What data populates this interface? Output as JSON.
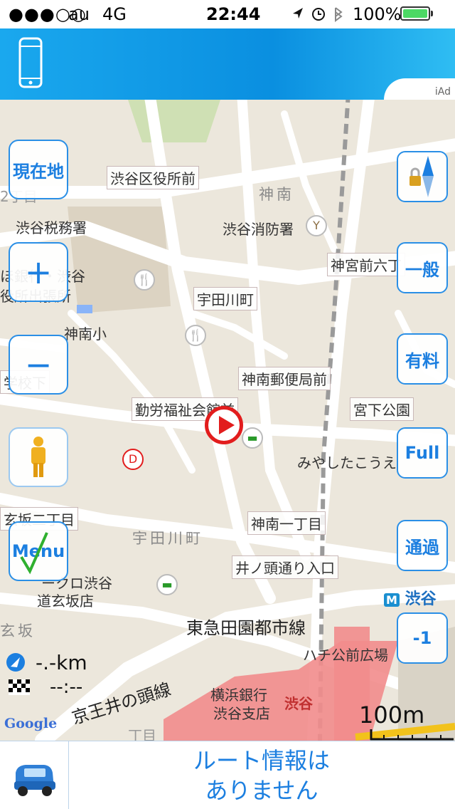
{
  "status_bar": {
    "signal": "●●●○○",
    "carrier": "au",
    "network": "4G",
    "time": "22:44",
    "battery": "100%"
  },
  "ad": {
    "label": "iAd"
  },
  "map": {
    "labels": {
      "shibuya_ward_office": "渋谷区役所前",
      "jinnan": "神南",
      "shibuya_tax_office": "渋谷税務署",
      "shibuya_fire_station": "渋谷消防署",
      "jingumae_6": "神宮前六丁",
      "udagawa_cho_stop": "宇田川町",
      "jinnan_elem": "神南小",
      "tokyo_branch": "ほ銀行・渋谷",
      "tokyo_branch2": "役所出張所",
      "jinnan_post": "神南郵便局前",
      "kinro": "勤労福祉会館前",
      "miyashita_park": "宮下公園",
      "miyashita_kouen": "みやしたこうえ",
      "gakkoushita": "学校下",
      "dogenzaka2": "玄坂二丁目",
      "udagawa_area": "宇田川町",
      "jinnan_1": "神南一丁目",
      "inokashira_entrance": "井ノ頭通り入口",
      "shibuya_dogenzaka": "ークロ渋谷",
      "dogenzaka_store": "道玄坂店",
      "shibuya_station": "渋谷",
      "toyoko_line": "東急田園都市線",
      "hachiko": "ハチ公前広場",
      "yokohama_bank": "横浜銀行",
      "shibuya_branch": "渋谷支店",
      "shibuya_pink": "渋谷",
      "inokashira_line": "京王井の頭線",
      "genzaka": "玄坂",
      "chome": "丁目",
      "two_chome": "2丁目"
    }
  },
  "controls": {
    "current_location": "現在地",
    "zoom_in": "+",
    "zoom_out": "−",
    "menu": "Menu",
    "general": "一般",
    "toll": "有料",
    "full": "Full",
    "pass": "通過",
    "minus_one": "-1"
  },
  "info": {
    "distance": "-.-km",
    "eta": "--:--",
    "scale": "100m",
    "attribution": "Google"
  },
  "bottom": {
    "route_line1": "ルート情報は",
    "route_line2": "ありません"
  },
  "colors": {
    "accent": "#1c7fe0",
    "ad_blue": "#0a8fe0",
    "nav_red": "#e21d1d",
    "station_pink": "#f08c8c",
    "battery_green": "#4cd964"
  }
}
